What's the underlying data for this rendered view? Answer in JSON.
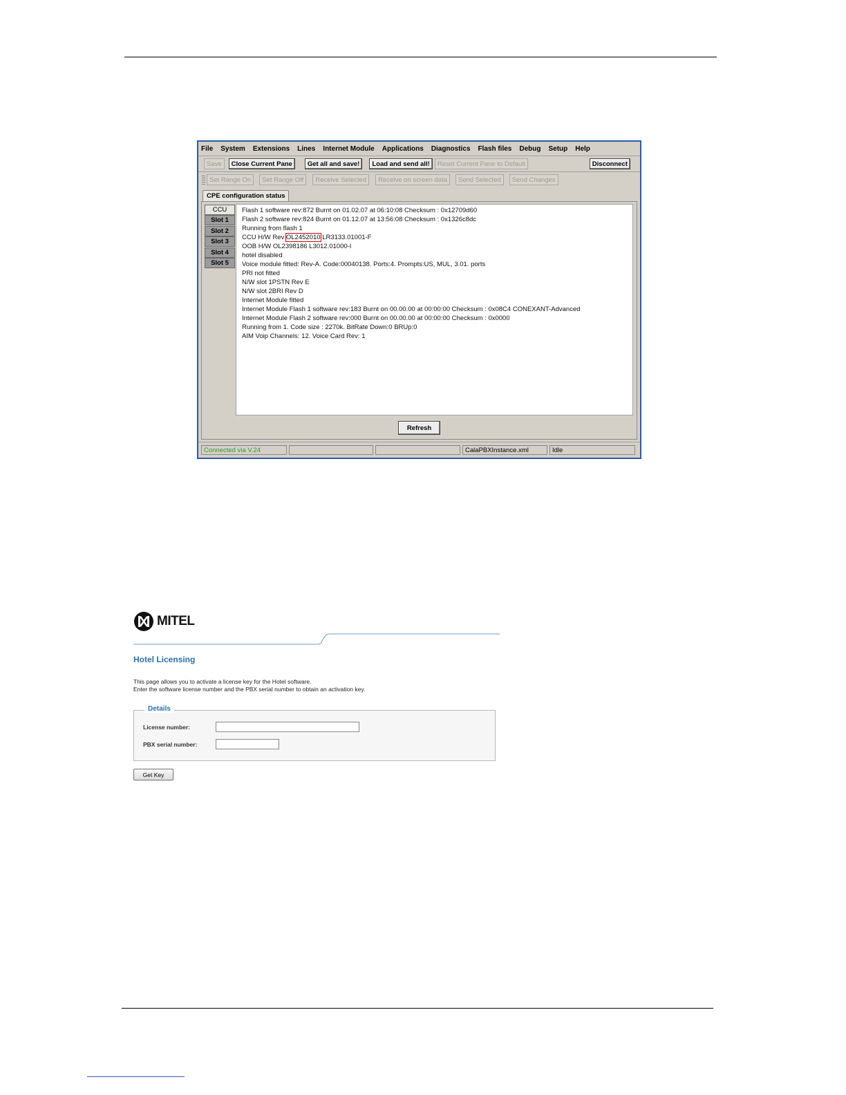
{
  "app": {
    "menu": [
      "File",
      "System",
      "Extensions",
      "Lines",
      "Internet Module",
      "Applications",
      "Diagnostics",
      "Flash files",
      "Debug",
      "Setup",
      "Help"
    ],
    "toolbar1": {
      "save": "Save",
      "close_pane": "Close Current Pane",
      "get_all": "Get all and save!",
      "load_send": "Load and send all!",
      "reset": "Reset Current Pane to Default",
      "disconnect": "Disconnect"
    },
    "toolbar2": {
      "set_range_on": "Set Range On",
      "set_range_off": "Set Range Off",
      "receive_selected": "Receive Selected",
      "receive_screen": "Receive on screen data",
      "send_selected": "Send Selected",
      "send_changes": "Send Changes"
    },
    "tab": "CPE configuration status",
    "slots": [
      "CCU",
      "Slot 1",
      "Slot 2",
      "Slot 3",
      "Slot 4",
      "Slot 5"
    ],
    "lines": [
      "Flash 1 software rev:872 Burnt on 01.02.07 at 06:10:08 Checksum : 0x12709d60",
      "Flash 2 software rev:824 Burnt on 01.12.07 at 13:56:08 Checksum : 0x1326c8dc",
      "Running from flash 1",
      "CCU H/W Rev",
      "OOB H/W OL2398186 L3012.01000-I",
      "hotel disabled",
      "Voice module fitted: Rev-A. Code:00040138. Ports:4. Prompts:US, MUL, 3.01. ports",
      "PRI not fitted",
      "N/W slot 1PSTN Rev E",
      "N/W slot 2BRI Rev D",
      "Internet Module fitted",
      "Internet Module Flash 1 software rev:183 Burnt on 00.00.00 at 00:00:00 Checksum : 0x08C4 CONEXANT-Advanced",
      "Internet Module Flash 2 software rev:000 Burnt on 00.00.00 at 00:00:00 Checksum : 0x0000",
      "Running from 1. Code size : 2270k. BitRate Down:0 BRUp:0",
      "AIM Voip  Channels: 12. Voice Card Rev: 1"
    ],
    "ccu_serial": "OL2452010",
    "ccu_suffix": "LR3133.01001-F",
    "refresh": "Refresh",
    "status": {
      "connection": "Connected via V.24",
      "cell2": "",
      "cell3": "",
      "file": "CalaPBXInstance.xml",
      "state": "Idle"
    }
  },
  "web": {
    "brand": "MITEL",
    "title": "Hotel Licensing",
    "intro1": "This page allows you to activate a license key for the Hotel software.",
    "intro2": "Enter the software license number and the PBX serial number to obtain an activation key.",
    "legend": "Details",
    "license_label": "License number:",
    "serial_label": "PBX serial number:",
    "license_value": "",
    "serial_value": "",
    "get_key": "Get Key"
  }
}
